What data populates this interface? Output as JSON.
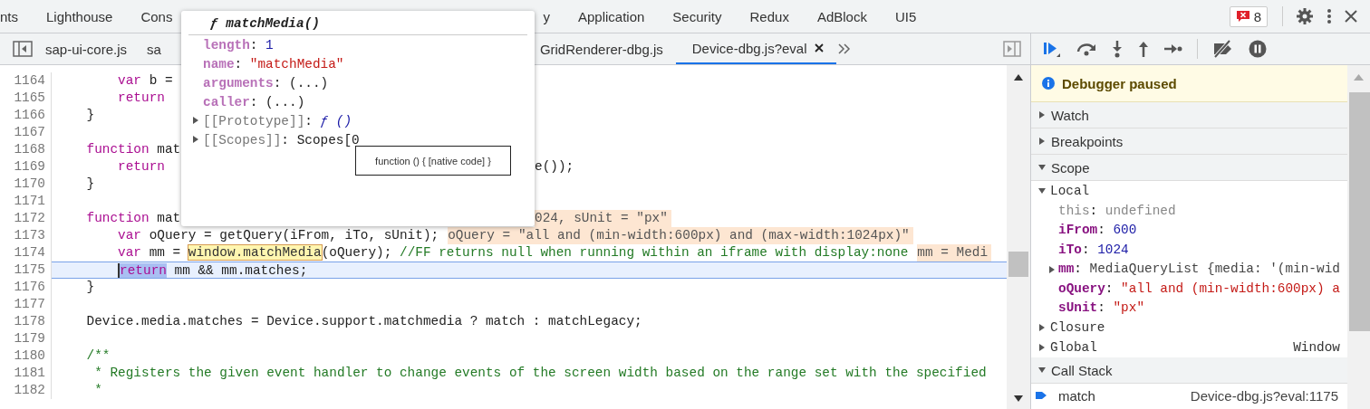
{
  "panel_tabs": [
    {
      "label": "nts",
      "selected": false
    },
    {
      "label": "Lighthouse",
      "selected": false
    },
    {
      "label": "Cons",
      "selected": false
    },
    {
      "label": "y",
      "selected": false
    },
    {
      "label": "Application",
      "selected": false
    },
    {
      "label": "Security",
      "selected": false
    },
    {
      "label": "Redux",
      "selected": false
    },
    {
      "label": "AdBlock",
      "selected": false
    },
    {
      "label": "UI5",
      "selected": false
    }
  ],
  "error_badge": {
    "count": "8"
  },
  "file_tabs": [
    {
      "label": "sap-ui-core.js",
      "selected": false
    },
    {
      "label": "sa",
      "selected": false
    },
    {
      "label": "GridRenderer-dbg.js",
      "selected": false
    },
    {
      "label": "Device-dbg.js?eval",
      "selected": true
    }
  ],
  "editor": {
    "lines": [
      {
        "number": "1164",
        "current": false,
        "code": [
          {
            "kind": "kw",
            "text": "        var"
          },
          {
            "kind": "plain",
            "text": " b ="
          }
        ]
      },
      {
        "number": "1165",
        "current": false,
        "code": [
          {
            "kind": "kw",
            "text": "        return"
          }
        ]
      },
      {
        "number": "1166",
        "current": false,
        "code": [
          {
            "kind": "plain",
            "text": "    }"
          }
        ]
      },
      {
        "number": "1167",
        "current": false
      },
      {
        "number": "1168",
        "current": false,
        "code": [
          {
            "kind": "kw",
            "text": "    function"
          },
          {
            "kind": "plain",
            "text": " mat"
          }
        ]
      },
      {
        "number": "1169",
        "current": false,
        "code": [
          {
            "kind": "kw",
            "text": "        return"
          }
        ],
        "after_popover": {
          "kind": "code",
          "code": [
            {
              "kind": "plain",
              "text": "e());"
            }
          ]
        }
      },
      {
        "number": "1170",
        "current": false,
        "code": [
          {
            "kind": "plain",
            "text": "    }"
          }
        ]
      },
      {
        "number": "1171",
        "current": false
      },
      {
        "number": "1172",
        "current": false,
        "code": [
          {
            "kind": "kw",
            "text": "    function"
          },
          {
            "kind": "plain",
            "text": " mat"
          }
        ],
        "after_popover": {
          "kind": "inline_value",
          "text": "024, sUnit = \"px\""
        }
      },
      {
        "number": "1173",
        "current": false,
        "code": [
          {
            "kind": "kw",
            "text": "        var"
          },
          {
            "kind": "plain",
            "text": " oQuery = getQuery(iFrom, iTo, sUnit);"
          }
        ],
        "inline_value": "oQuery = \"all and (min-width:600px) and (max-width:1024px)\""
      },
      {
        "number": "1174",
        "current": false,
        "code": [
          {
            "kind": "kw",
            "text": "        var"
          },
          {
            "kind": "plain",
            "text": " mm = "
          },
          {
            "kind": "hover",
            "text": "window.matchMedia"
          },
          {
            "kind": "plain",
            "text": "(oQuery); "
          },
          {
            "kind": "comment",
            "text": "//FF returns null when running within an iframe with display:none"
          }
        ],
        "inline_value": "mm = Medi"
      },
      {
        "number": "1175",
        "current": true,
        "code": [
          {
            "kind": "exec",
            "text": "        return"
          },
          {
            "kind": "plain",
            "text": " mm && mm.matches;"
          }
        ]
      },
      {
        "number": "1176",
        "current": false,
        "code": [
          {
            "kind": "plain",
            "text": "    }"
          }
        ]
      },
      {
        "number": "1177",
        "current": false
      },
      {
        "number": "1178",
        "current": false,
        "code": [
          {
            "kind": "plain",
            "text": "    Device.media.matches = Device.support.matchmedia ? match : matchLegacy;"
          }
        ]
      },
      {
        "number": "1179",
        "current": false
      },
      {
        "number": "1180",
        "current": false,
        "code": [
          {
            "kind": "comment",
            "text": "    /**"
          }
        ]
      },
      {
        "number": "1181",
        "current": false,
        "code": [
          {
            "kind": "comment",
            "text": "     * Registers the given event handler to change events of the screen width based on the range set with the specified"
          }
        ]
      },
      {
        "number": "1182",
        "current": false,
        "code": [
          {
            "kind": "comment",
            "text": "     *"
          }
        ]
      }
    ]
  },
  "popover": {
    "title": "matchMedia()",
    "glyph": "ƒ",
    "properties": [
      {
        "name": "length:",
        "value": "1",
        "kind": "number",
        "internal": false,
        "expandable": false
      },
      {
        "name": "name:",
        "value": "\"matchMedia\"",
        "kind": "string",
        "internal": false,
        "expandable": false
      },
      {
        "name": "arguments:",
        "value": "(...)",
        "kind": "plain",
        "internal": false,
        "expandable": false
      },
      {
        "name": "caller:",
        "value": "(...)",
        "kind": "plain",
        "internal": false,
        "expandable": false
      },
      {
        "name": "[[Prototype]]:",
        "value": "ƒ ()",
        "kind": "function",
        "internal": true,
        "expandable": true
      },
      {
        "name": "[[Scopes]]:",
        "value": "Scopes[0",
        "kind": "plain",
        "internal": true,
        "expandable": true
      }
    ],
    "tooltip": "function () { [native code] }"
  },
  "debugger": {
    "banner": "Debugger paused",
    "sections": [
      {
        "title": "Watch",
        "expanded": false
      },
      {
        "title": "Breakpoints",
        "expanded": false
      },
      {
        "title": "Scope",
        "expanded": true,
        "groups": [
          {
            "title": "Local",
            "expanded": true,
            "variables": [
              {
                "name": "this:",
                "value": "undefined",
                "kind": "undefined",
                "expandable": false
              },
              {
                "name": "iFrom:",
                "value": "600",
                "kind": "number",
                "expandable": false
              },
              {
                "name": "iTo:",
                "value": "1024",
                "kind": "number",
                "expandable": false
              },
              {
                "name": "mm:",
                "value": "MediaQueryList {media: '(min-wid",
                "kind": "object",
                "expandable": true
              },
              {
                "name": "oQuery:",
                "value": "\"all and (min-width:600px) a",
                "kind": "string",
                "expandable": false
              },
              {
                "name": "sUnit:",
                "value": "\"px\"",
                "kind": "string",
                "expandable": false
              }
            ]
          },
          {
            "title": "Closure",
            "expanded": false
          },
          {
            "title": "Global",
            "expanded": false,
            "value": "Window"
          }
        ]
      },
      {
        "title": "Call Stack",
        "expanded": true,
        "frames": [
          {
            "name": "match",
            "location": "Device-dbg.js?eval:1175",
            "selected": true
          }
        ]
      }
    ]
  }
}
